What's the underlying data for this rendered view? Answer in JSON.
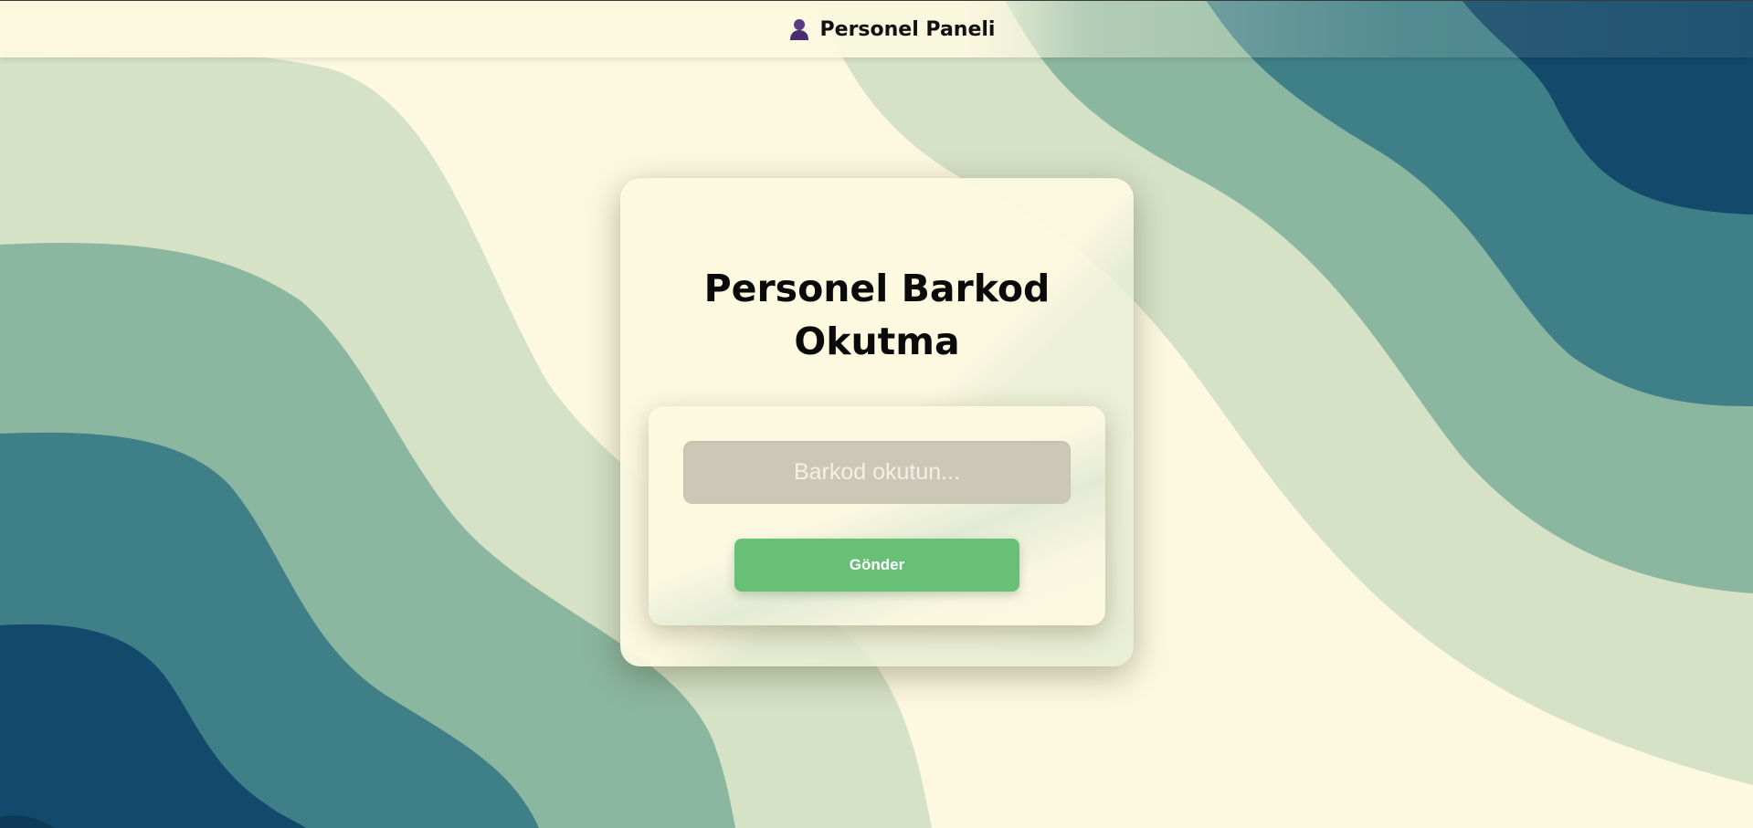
{
  "header": {
    "icon": "user-icon",
    "title": "Personel Paneli"
  },
  "card": {
    "title_line1": "Personel Barkod",
    "title_line2": "Okutma"
  },
  "form": {
    "barcode_placeholder": "Barkod okutun...",
    "barcode_value": "",
    "submit_label": "Gönder"
  },
  "colors": {
    "cream": "#fdf9e1",
    "pale_green": "#d5e2c6",
    "sage": "#8bb6a0",
    "teal": "#3e7f88",
    "navy": "#134a6b",
    "button_green": "#68bf76",
    "input_bg": "#cbc8b6"
  }
}
